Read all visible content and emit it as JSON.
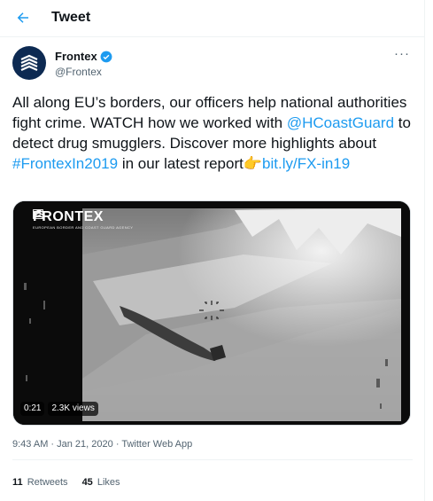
{
  "header": {
    "title": "Tweet",
    "back_icon": "arrow-left-icon"
  },
  "author": {
    "name": "Frontex",
    "handle": "@Frontex",
    "verified_icon": "verified-badge-icon",
    "more_icon": "more-options-icon",
    "more_label": "···"
  },
  "tweet": {
    "text_1": "All along EU’s borders, our officers help national authorities fight crime. WATCH how we worked with ",
    "mention": "@HCoastGuard",
    "text_2": " to detect drug smugglers. Discover more highlights about ",
    "hashtag": "#FrontexIn2019",
    "text_3": " in our latest report",
    "emoji": "👉",
    "link": "bit.ly/FX-in19"
  },
  "media": {
    "logo_text": "FRONTEX",
    "logo_subtext": "EUROPEAN BORDER AND COAST GUARD AGENCY",
    "duration": "0:21",
    "views": "2.3K views"
  },
  "meta": {
    "time": "9:43 AM",
    "separator_1": " · ",
    "date": "Jan 21, 2020",
    "separator_2": " · ",
    "source": "Twitter Web App"
  },
  "stats": {
    "retweets_count": "11",
    "retweets_label": "Retweets",
    "likes_count": "45",
    "likes_label": "Likes"
  },
  "colors": {
    "accent": "#1d9bf0",
    "text": "#0f1419",
    "secondary": "#536471",
    "avatar_bg": "#0d2a52"
  }
}
